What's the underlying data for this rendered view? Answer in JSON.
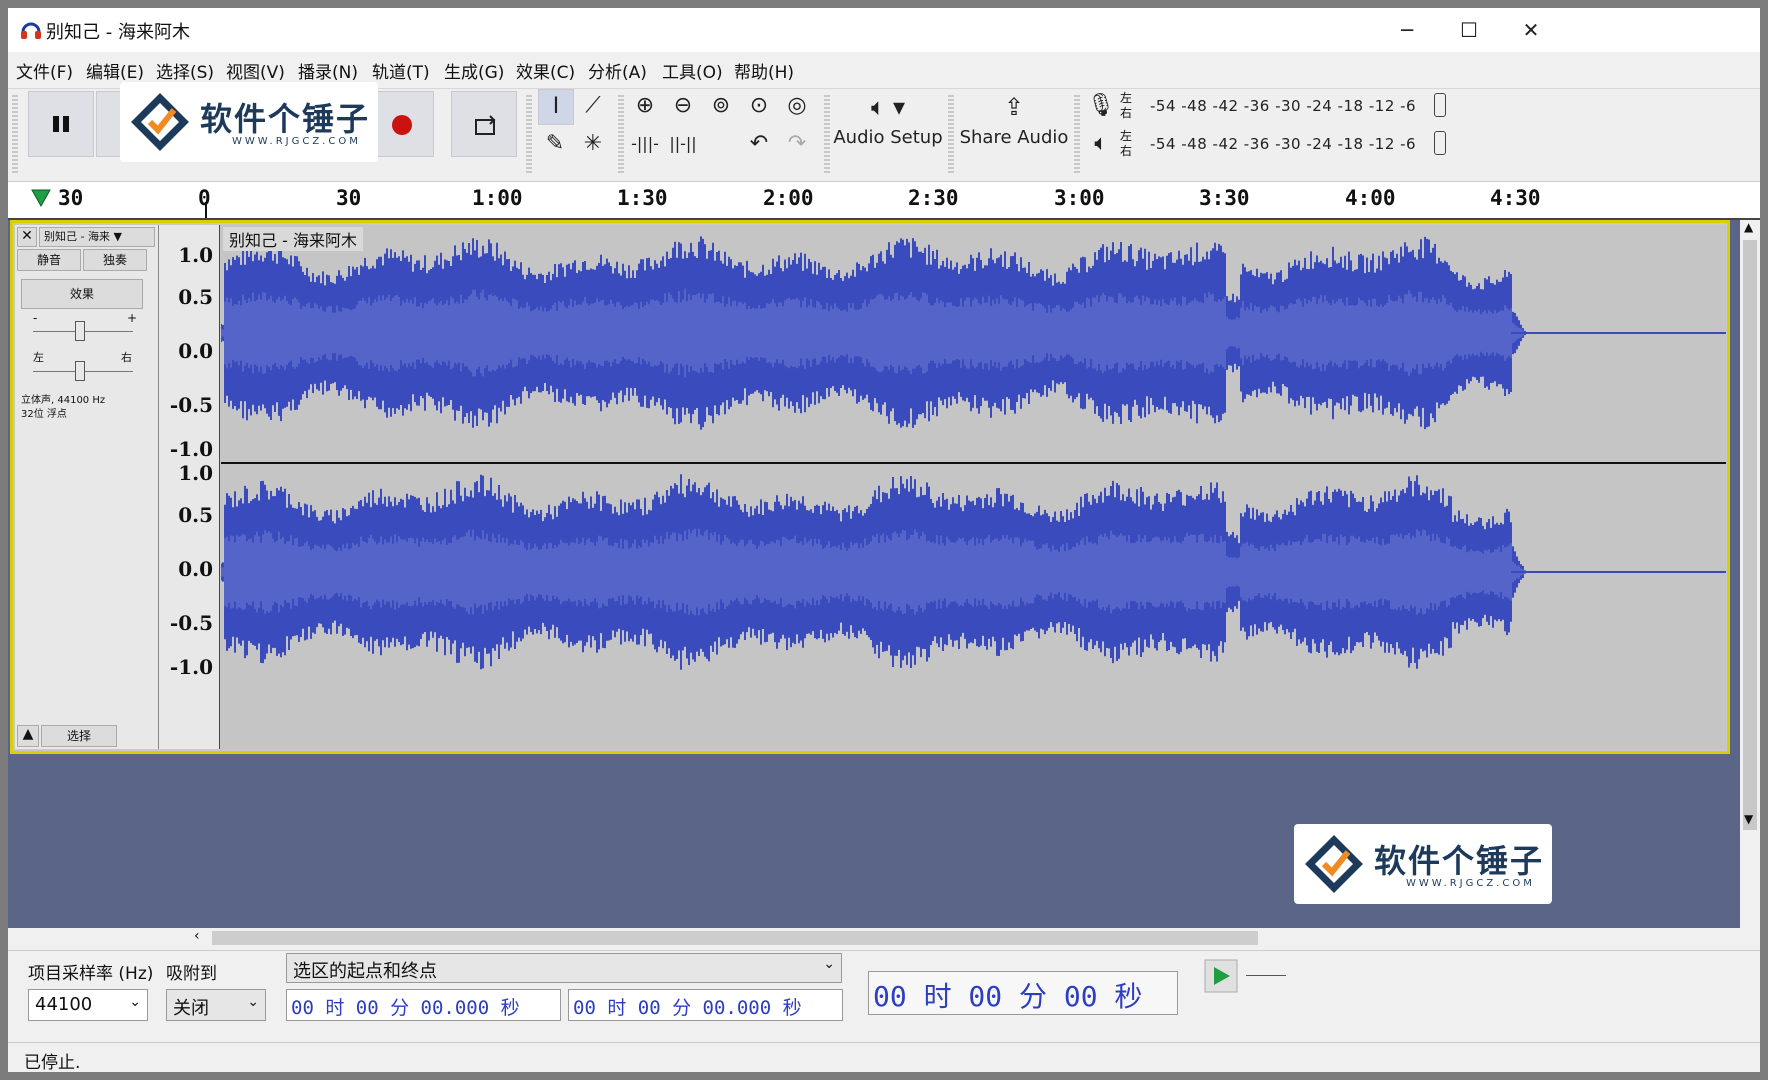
{
  "window": {
    "title": "别知己 - 海来阿木",
    "controls": {
      "minimize": "─",
      "maximize": "☐",
      "close": "✕"
    }
  },
  "menu": [
    "文件(F)",
    "编辑(E)",
    "选择(S)",
    "视图(V)",
    "播录(N)",
    "轨道(T)",
    "生成(G)",
    "效果(C)",
    "分析(A)",
    "工具(O)",
    "帮助(H)"
  ],
  "toolbar": {
    "audio_setup": "Audio Setup",
    "share_audio": "Share Audio",
    "meter_scale": "-54 -48 -42 -36 -30 -24 -18 -12 -6",
    "meter_rec_label": "左右",
    "meter_play_label": "左右",
    "icons": {
      "pause": "pause-icon",
      "record": "record-icon",
      "loop": "loop-icon",
      "select": "i-beam-icon",
      "envelope": "envelope-icon",
      "draw": "pencil-icon",
      "multi": "multi-tool-icon",
      "zoom_in": "zoom-in-icon",
      "zoom_out": "zoom-out-icon",
      "fit_sel": "fit-selection-icon",
      "fit_proj": "fit-project-icon",
      "zoom_toggle": "zoom-toggle-icon",
      "trim": "trim-icon",
      "silence": "silence-icon",
      "undo": "undo-icon",
      "redo": "redo-icon",
      "mic": "microphone-icon",
      "speaker": "speaker-icon"
    }
  },
  "ruler": {
    "labels": [
      "30",
      "0",
      "30",
      "1:00",
      "1:30",
      "2:00",
      "2:30",
      "3:00",
      "3:30",
      "4:00",
      "4:30"
    ]
  },
  "track": {
    "name": "别知己 - 海来",
    "clip_title": "别知己 - 海来阿木",
    "mute": "静音",
    "solo": "独奏",
    "effects": "效果",
    "gain_minus": "-",
    "gain_plus": "+",
    "pan_left": "左",
    "pan_right": "右",
    "info_line1": "立体声, 44100 Hz",
    "info_line2": "32位 浮点",
    "select": "选择",
    "scale_labels": [
      "1.0",
      "0.5",
      "0.0",
      "-0.5",
      "-1.0"
    ]
  },
  "selection": {
    "rate_label": "项目采样率 (Hz)",
    "snap_label": "吸附到",
    "rate_value": "44100",
    "snap_value": "关闭",
    "mode": "选区的起点和终点",
    "start_time": "00 时 00 分 00.000 秒",
    "end_time": "00 时 00 分 00.000 秒",
    "position": "00 时 00 分 00 秒"
  },
  "status": "已停止.",
  "watermark": {
    "text": "软件个锤子",
    "url": "WWW.RJGCZ.COM"
  },
  "colors": {
    "waveform": "#3a4bbd",
    "waveform_rms": "#5564c8",
    "track_bg": "#5b6587",
    "selection_border": "#d8d000",
    "record": "#cc1111",
    "play": "#1f9e44"
  }
}
